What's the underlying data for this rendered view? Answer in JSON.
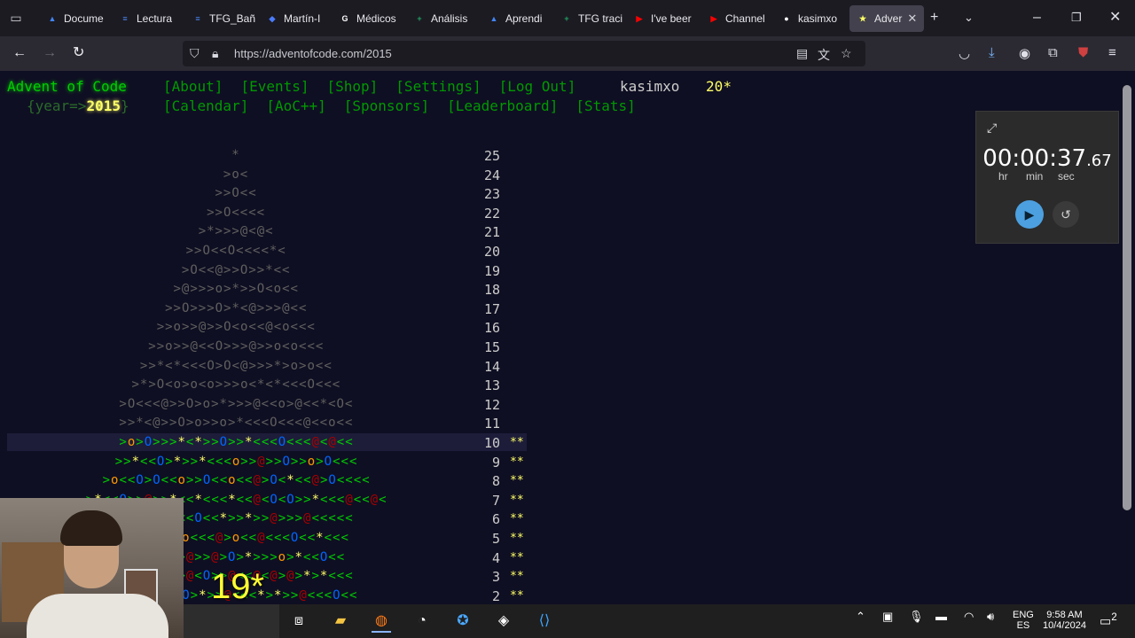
{
  "browser": {
    "tabs": [
      {
        "label": "Docume",
        "fav_color": "#4285f4",
        "fav_glyph": "▲"
      },
      {
        "label": "Lectura",
        "fav_color": "#4a86f0",
        "fav_glyph": "≡"
      },
      {
        "label": "TFG_Bañ",
        "fav_color": "#4a86f0",
        "fav_glyph": "≡"
      },
      {
        "label": "Martín-I",
        "fav_color": "#4a7cff",
        "fav_glyph": "◆"
      },
      {
        "label": "Médicos",
        "fav_color": "#ffffff",
        "fav_glyph": "G"
      },
      {
        "label": "Análisis",
        "fav_color": "#1ea362",
        "fav_glyph": "+"
      },
      {
        "label": "Aprendi",
        "fav_color": "#4285f4",
        "fav_glyph": "▲"
      },
      {
        "label": "TFG traci",
        "fav_color": "#1ea362",
        "fav_glyph": "+"
      },
      {
        "label": "I've beer",
        "fav_color": "#ff0000",
        "fav_glyph": "▶"
      },
      {
        "label": "Channel",
        "fav_color": "#ff0000",
        "fav_glyph": "▶"
      },
      {
        "label": "kasimxo",
        "fav_color": "#ffffff",
        "fav_glyph": "●"
      },
      {
        "label": "Adver",
        "fav_color": "#ffff66",
        "fav_glyph": "★"
      }
    ],
    "url": "https://adventofcode.com/2015"
  },
  "aoc": {
    "title": "Advent of Code",
    "year_prefix": "{year=>",
    "year": "2015",
    "year_suffix": "}",
    "menu_row1": [
      "[About]",
      "[Events]",
      "[Shop]",
      "[Settings]",
      "[Log Out]"
    ],
    "menu_row2": [
      "[Calendar]",
      "[AoC++]",
      "[Sponsors]",
      "[Leaderboard]",
      "[Stats]"
    ],
    "username": "kasimxo",
    "user_stars": "20*"
  },
  "calendar": {
    "rows": [
      {
        "day": "25",
        "art": "*",
        "stars": ""
      },
      {
        "day": "24",
        "art": ">o<",
        "stars": ""
      },
      {
        "day": "23",
        "art": ">>O<<",
        "stars": ""
      },
      {
        "day": "22",
        "art": ">>O<<<<",
        "stars": ""
      },
      {
        "day": "21",
        "art": ">*>>>@<@<",
        "stars": ""
      },
      {
        "day": "20",
        "art": ">>O<<O<<<<*<",
        "stars": ""
      },
      {
        "day": "19",
        "art": ">O<<@>>O>>*<<",
        "stars": ""
      },
      {
        "day": "18",
        "art": ">@>>>o>*>>O<o<<",
        "stars": ""
      },
      {
        "day": "17",
        "art": ">>O>>>O>*<@>>>@<<",
        "stars": ""
      },
      {
        "day": "16",
        "art": ">>o>>@>>O<o<<@<o<<<",
        "stars": ""
      },
      {
        "day": "15",
        "art": ">>o>>@<<O>>>@>>o<o<<<",
        "stars": ""
      },
      {
        "day": "14",
        "art": ">>*<*<<<O>O<@>>>*>o>o<<",
        "stars": ""
      },
      {
        "day": "13",
        "art": ">*>O<o>o<o>>>o<*<*<<<O<<<",
        "stars": ""
      },
      {
        "day": "12",
        "art": ">O<<<@>>O>o>*>>>@<<o>@<<*<O<",
        "stars": ""
      },
      {
        "day": "11",
        "art": ">>*<@>>O>o>>o>*<<<O<<<@<<o<<",
        "stars": ""
      },
      {
        "day": "10",
        "art": ">o>O>>>*<*>>O>>*<<<O<<<@<@<<",
        "stars": "**"
      },
      {
        "day": "9",
        "art": ">>*<<O>*>>*<<<o>>@>>O>>o>O<<<",
        "stars": "**"
      },
      {
        "day": "8",
        "art": ">o<<O>O<<o>>O<<o<<@>O<*<<@>O<<<<",
        "stars": "**"
      },
      {
        "day": "7",
        "art": ">*<<O>>@>>*<<*<<<*<<@<O<O>>*<<<@<<@<",
        "stars": "**"
      },
      {
        "day": "6",
        "art": ">>*<<*<<<O<<*>>*>>@>>>@<<<<<",
        "stars": "**"
      },
      {
        "day": "5",
        "art": ">>o>*<<o<<<@>o<<@<<<O<<*<<<",
        "stars": "**"
      },
      {
        "day": "4",
        "art": ">>@<*>>@>>@>O>*>>>o>*<<O<<",
        "stars": "**"
      },
      {
        "day": "3",
        "art": ">>@<<O>>@<O>>@<<@<@>@>*>*<<<",
        "stars": "**"
      },
      {
        "day": "2",
        "art": ">>o>>*>>O>*>>@<<<*>*>>@<<<O<<",
        "stars": "**"
      }
    ]
  },
  "timer": {
    "time_main": "00:00:37",
    "time_frac": ".67",
    "labels": [
      "hr",
      "min",
      "sec"
    ]
  },
  "overlay": {
    "counter": "19*"
  },
  "taskbar": {
    "lang_top": "ENG",
    "lang_bottom": "ES",
    "time": "9:58 AM",
    "date": "10/4/2024",
    "notif_count": "2"
  }
}
